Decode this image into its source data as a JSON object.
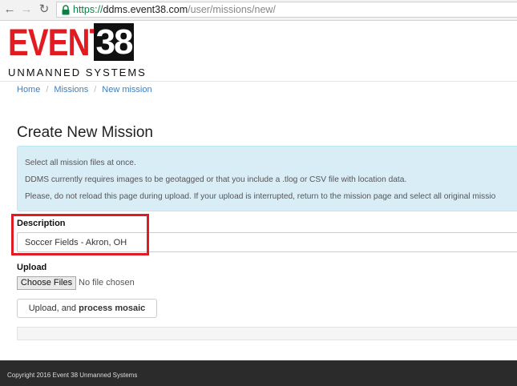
{
  "browser": {
    "url_scheme": "https://",
    "url_host": "ddms.event38.com",
    "url_path": "/user/missions/new/",
    "back_icon": "arrow-left-icon",
    "forward_icon": "arrow-right-icon",
    "reload_icon": "reload-icon",
    "lock_icon": "lock-icon",
    "secure_color": "#0b8043"
  },
  "logo": {
    "word": "EVENT",
    "number": "38",
    "tagline": "UNMANNED SYSTEMS",
    "brand_red": "#e21b23"
  },
  "breadcrumb": [
    "Home",
    "Missions",
    "New mission"
  ],
  "page_title": "Create New Mission",
  "alert": {
    "lines": [
      "Select all mission files at once.",
      "DDMS currently requires images to be geotagged or that you include a .tlog or CSV file with location data.",
      "Please, do not reload this page during upload. If your upload is interrupted, return to the mission page and select all original missio"
    ]
  },
  "form": {
    "description_label": "Description",
    "description_value": "Soccer Fields - Akron, OH",
    "upload_label": "Upload",
    "choose_files_label": "Choose Files",
    "no_file_text": "No file chosen",
    "submit_prefix": "Upload, and ",
    "submit_bold": "process mosaic"
  },
  "highlight_color": "#e01b24",
  "footer": {
    "copyright": "Copyright 2016 Event 38 Unmanned Systems"
  }
}
